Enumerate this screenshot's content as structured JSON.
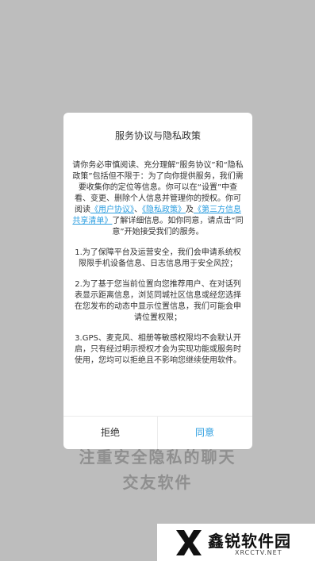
{
  "background": {
    "tagline_line1": "注重安全隐私的聊天",
    "tagline_line2": "交友软件"
  },
  "dialog": {
    "title": "服务协议与隐私政策",
    "intro_before_links": "请你务必审慎阅读、充分理解“服务协议”和“隐私政策”包括但不限于：为了向你提供服务，我们需要收集你的定位等信息。你可以在“设置”中查看、变更、删除个人信息并管理你的授权。你可阅读",
    "link_user_agreement": "《用户协议》",
    "sep1": "、",
    "link_privacy_policy": "《隐私政策》",
    "sep2": "及",
    "link_third_party": "《第三方信息共享清单》",
    "intro_after_links": "了解详细信息。如你同意，请点击“同意”开始接受我们的服务。",
    "item1": "1.为了保障平台及运营安全，我们会申请系统权限限手机设备信息、日志信息用于安全风控；",
    "item2": "2.为了基于您当前位置向您推荐用户、在对话列表显示距离信息，浏览同城社区信息或经您选择在您发布的动态中显示位置信息，我们可能会申请位置权限；",
    "item3": "3.GPS、麦克风、相册等敏感权限均不会默认开启，只有经过明示授权才会为实现功能或服务时使用，您均可以拒绝且不影响您继续使用软件。",
    "reject_label": "拒绝",
    "agree_label": "同意",
    "link_color": "#2f9fe0"
  },
  "watermark": {
    "name": "鑫锐软件园",
    "site": "XRCCTV.NET",
    "logo_icon": "x-logo-icon"
  }
}
